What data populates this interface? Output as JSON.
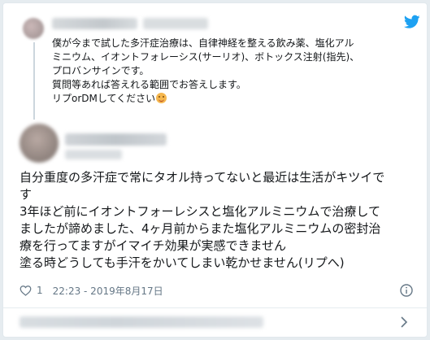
{
  "parent_tweet": {
    "text_lines": [
      "僕が今まで試した多汗症治療は、自律神経を整える飲み薬、塩化アル",
      "ミニウム、イオントフォレーシス(サーリオ)、ボトックス注射(指先)、",
      "プロバンサインです。",
      "質問等あれば答えれる範囲でお答えします。",
      "リプorDMしてください"
    ],
    "emoji_icon": "smiling-face-icon",
    "platform_icon": "twitter-bird-icon"
  },
  "main_tweet": {
    "text_lines": [
      "自分重度の多汗症で常にタオル持ってないと最近は生活がキツイで",
      "す",
      "3年ほど前にイオントフォーレシスと塩化アルミニウムで治療して",
      "ましたが諦めました、4ヶ月前からまた塩化アルミニウムの密封治",
      "療を行ってますがイマイチ効果が実感できません",
      "塗る時どうしても手汗をかいてしまい乾かせません(リプへ)"
    ],
    "like_count": "1",
    "timestamp": "22:23 - 2019年8月17日"
  },
  "colors": {
    "text": "#14171a",
    "meta": "#657786",
    "twitter_blue": "#1da1f2",
    "background": "#e6ecf0",
    "border": "#e1e8ed"
  }
}
